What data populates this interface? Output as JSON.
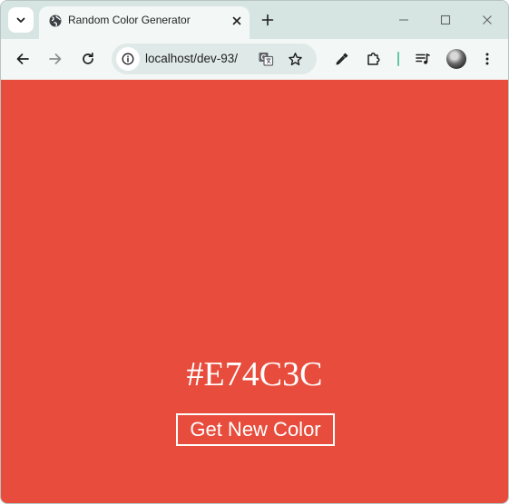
{
  "browser": {
    "tab_title": "Random Color Generator",
    "url": "localhost/dev-93/"
  },
  "icons": {
    "tab_search": "chevron-down-icon",
    "tab_favicon": "globe-icon",
    "tab_close": "close-icon",
    "new_tab": "plus-icon",
    "minimize": "minimize-icon",
    "maximize": "maximize-icon",
    "close_window": "close-icon",
    "back": "arrow-left-icon",
    "forward": "arrow-right-icon",
    "reload": "reload-icon",
    "site_info": "info-icon",
    "translate": "translate-icon",
    "bookmark": "star-icon",
    "eyedropper": "eyedropper-icon",
    "extensions": "puzzle-icon",
    "media": "media-queue-icon",
    "profile": "avatar",
    "menu": "more-vertical-icon"
  },
  "page": {
    "background_color": "#E74C3C",
    "color_code": "#E74C3C",
    "button_label": "Get New Color"
  }
}
